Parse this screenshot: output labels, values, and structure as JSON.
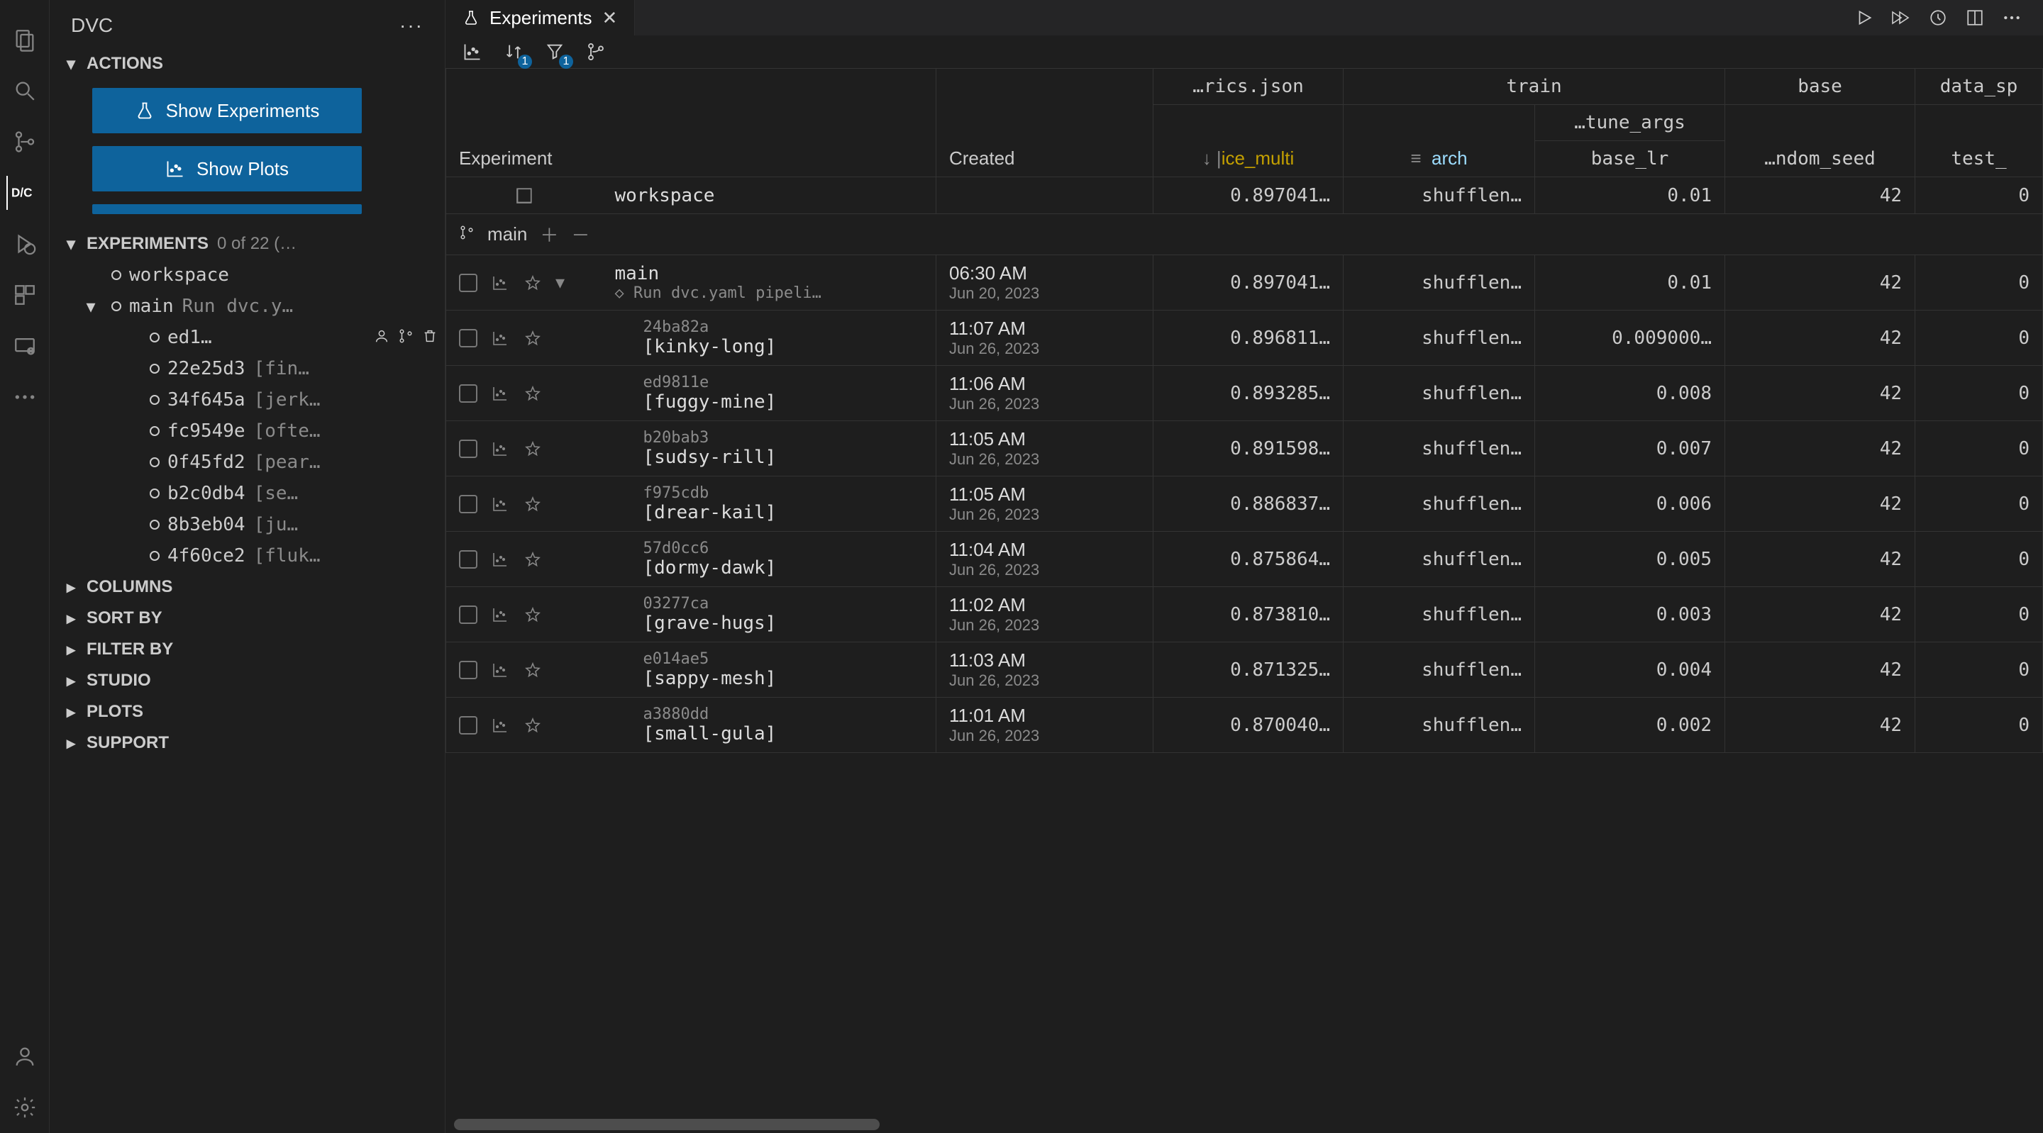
{
  "sidebar": {
    "title": "DVC",
    "sections": {
      "actions": {
        "label": "ACTIONS",
        "buttons": {
          "show_experiments": "Show Experiments",
          "show_plots": "Show Plots"
        }
      },
      "experiments": {
        "label": "EXPERIMENTS",
        "count": "0 of 22 (…",
        "tree": {
          "workspace": "workspace",
          "main": {
            "label": "main",
            "sub": "Run dvc.y…"
          },
          "children": [
            {
              "hash": "ed1…",
              "sub": ""
            },
            {
              "hash": "22e25d3",
              "sub": "[fin…"
            },
            {
              "hash": "34f645a",
              "sub": "[jerk…"
            },
            {
              "hash": "fc9549e",
              "sub": "[ofte…"
            },
            {
              "hash": "0f45fd2",
              "sub": "[pear…"
            },
            {
              "hash": "b2c0db4",
              "sub": "[se…"
            },
            {
              "hash": "8b3eb04",
              "sub": "[ju…"
            },
            {
              "hash": "4f60ce2",
              "sub": "[fluk…"
            }
          ]
        }
      },
      "columns": {
        "label": "COLUMNS"
      },
      "sort_by": {
        "label": "SORT BY"
      },
      "filter_by": {
        "label": "FILTER BY"
      },
      "studio": {
        "label": "STUDIO"
      },
      "plots": {
        "label": "PLOTS"
      },
      "support": {
        "label": "SUPPORT"
      }
    }
  },
  "tab": {
    "title": "Experiments"
  },
  "toolbar": {
    "sort_badge": "1",
    "filter_badge": "1"
  },
  "table": {
    "group_headers": {
      "metrics": "…rics.json",
      "train": "train",
      "base": "base",
      "data_sp": "data_sp",
      "tune_args": "…tune_args"
    },
    "columns": {
      "experiment": "Experiment",
      "created": "Created",
      "ice_multi": "ice_multi",
      "arch": "arch",
      "base_lr": "base_lr",
      "random_seed": "…ndom_seed",
      "test": "test_"
    },
    "workspace": {
      "name": "workspace",
      "metric": "0.897041…",
      "arch": "shufflen…",
      "base_lr": "0.01",
      "seed": "42",
      "test": "0"
    },
    "branch": {
      "name": "main"
    },
    "main_row": {
      "name": "main",
      "desc": "Run dvc.yaml pipeli…",
      "time": "06:30 AM",
      "date": "Jun 20, 2023",
      "metric": "0.897041…",
      "arch": "shufflen…",
      "base_lr": "0.01",
      "seed": "42",
      "test": "0"
    },
    "rows": [
      {
        "hash": "24ba82a",
        "title": "[kinky-long]",
        "time": "11:07 AM",
        "date": "Jun 26, 2023",
        "metric": "0.896811…",
        "arch": "shufflen…",
        "base_lr": "0.009000…",
        "seed": "42",
        "test": "0"
      },
      {
        "hash": "ed9811e",
        "title": "[fuggy-mine]",
        "time": "11:06 AM",
        "date": "Jun 26, 2023",
        "metric": "0.893285…",
        "arch": "shufflen…",
        "base_lr": "0.008",
        "seed": "42",
        "test": "0"
      },
      {
        "hash": "b20bab3",
        "title": "[sudsy-rill]",
        "time": "11:05 AM",
        "date": "Jun 26, 2023",
        "metric": "0.891598…",
        "arch": "shufflen…",
        "base_lr": "0.007",
        "seed": "42",
        "test": "0"
      },
      {
        "hash": "f975cdb",
        "title": "[drear-kail]",
        "time": "11:05 AM",
        "date": "Jun 26, 2023",
        "metric": "0.886837…",
        "arch": "shufflen…",
        "base_lr": "0.006",
        "seed": "42",
        "test": "0"
      },
      {
        "hash": "57d0cc6",
        "title": "[dormy-dawk]",
        "time": "11:04 AM",
        "date": "Jun 26, 2023",
        "metric": "0.875864…",
        "arch": "shufflen…",
        "base_lr": "0.005",
        "seed": "42",
        "test": "0"
      },
      {
        "hash": "03277ca",
        "title": "[grave-hugs]",
        "time": "11:02 AM",
        "date": "Jun 26, 2023",
        "metric": "0.873810…",
        "arch": "shufflen…",
        "base_lr": "0.003",
        "seed": "42",
        "test": "0"
      },
      {
        "hash": "e014ae5",
        "title": "[sappy-mesh]",
        "time": "11:03 AM",
        "date": "Jun 26, 2023",
        "metric": "0.871325…",
        "arch": "shufflen…",
        "base_lr": "0.004",
        "seed": "42",
        "test": "0"
      },
      {
        "hash": "a3880dd",
        "title": "[small-gula]",
        "time": "11:01 AM",
        "date": "Jun 26, 2023",
        "metric": "0.870040…",
        "arch": "shufflen…",
        "base_lr": "0.002",
        "seed": "42",
        "test": "0"
      }
    ]
  }
}
